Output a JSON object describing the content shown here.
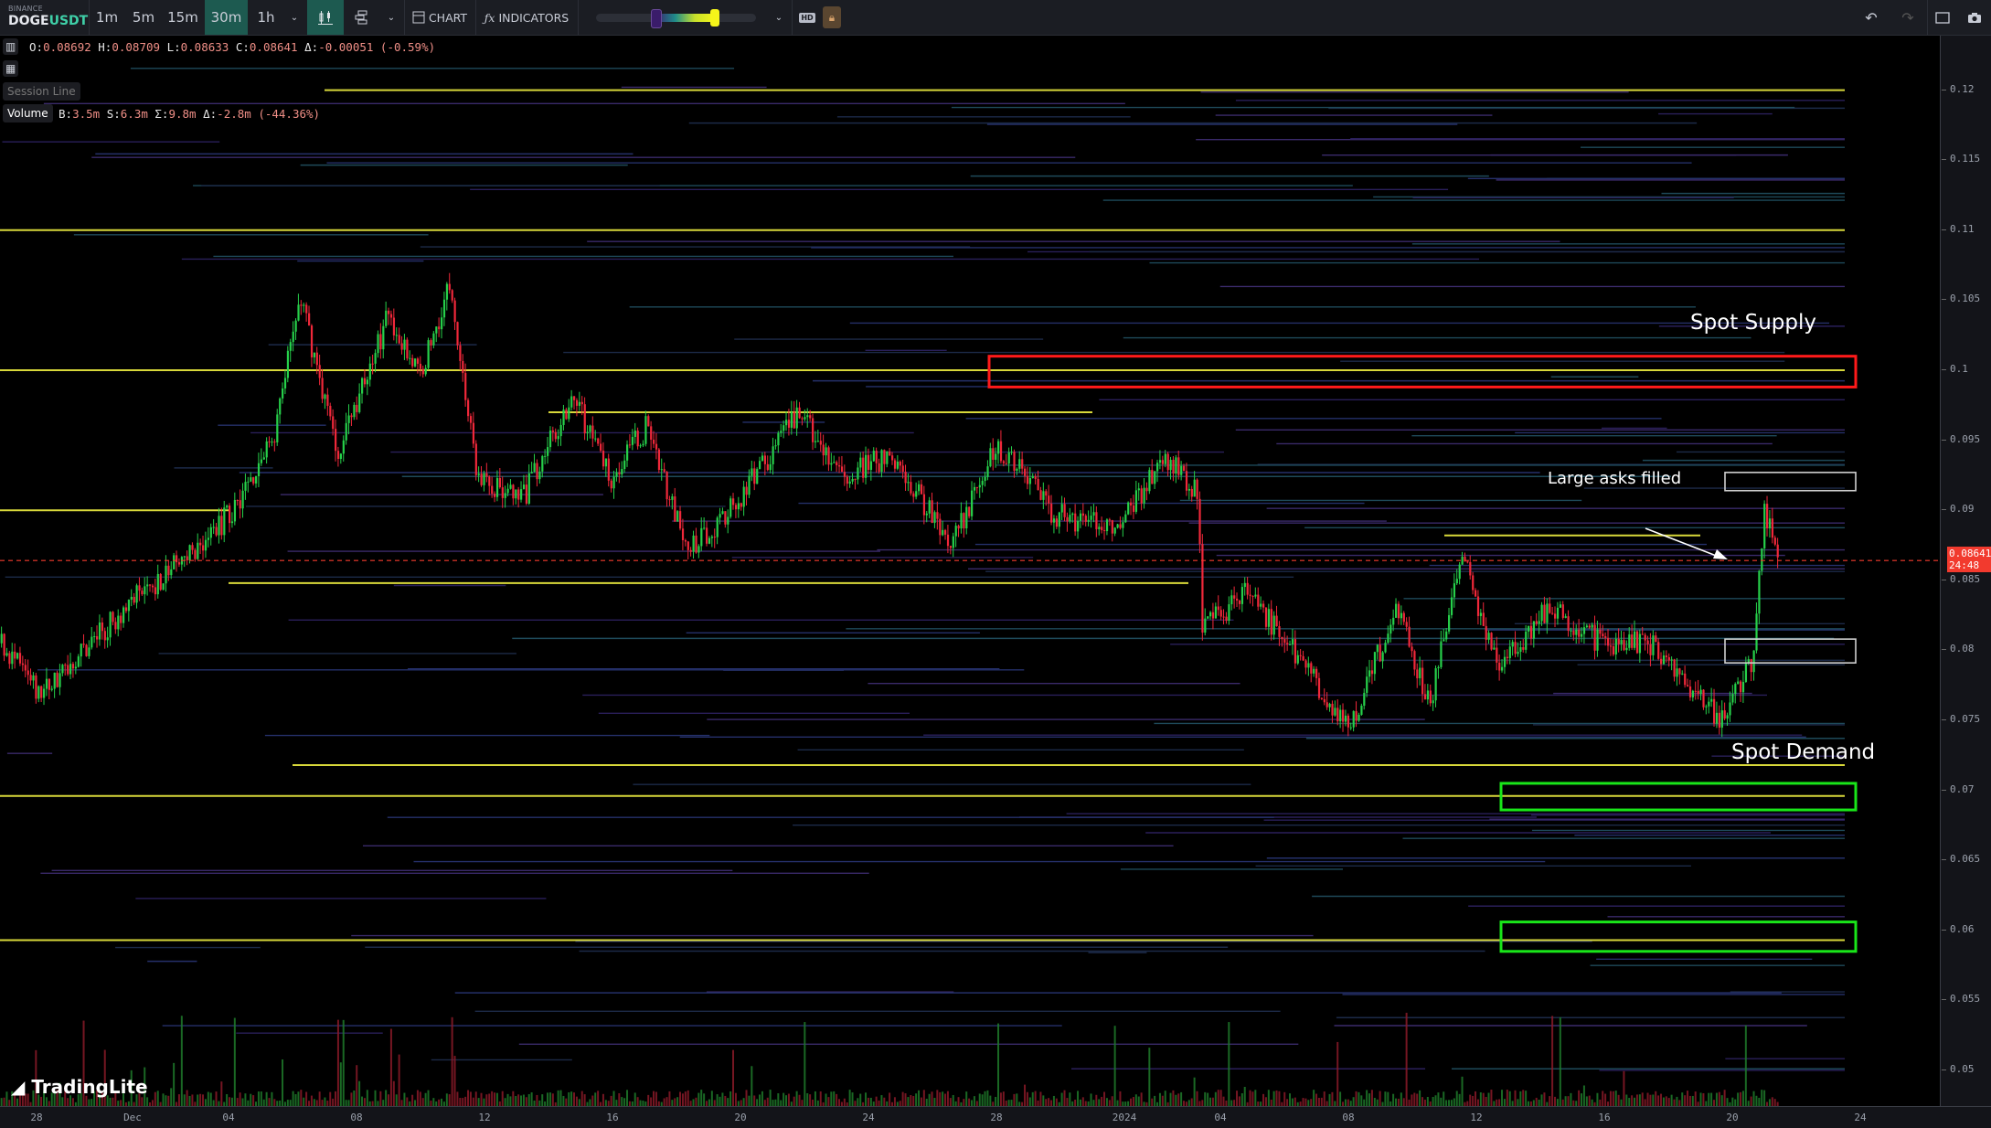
{
  "toolbar": {
    "exchange": "BINANCE",
    "symbol_base": "DOGE",
    "symbol_quote": "USDT",
    "timeframes": [
      "1m",
      "5m",
      "15m",
      "30m",
      "1h"
    ],
    "active_timeframe": "30m",
    "chart_label": "CHART",
    "indicators_label": "INDICATORS",
    "hd_label": "HD",
    "heatmap_gradient_low": 0.23,
    "heatmap_gradient_high": 0.6
  },
  "ohlc": {
    "o_label": "O:",
    "o": "0.08692",
    "h_label": "H:",
    "h": "0.08709",
    "l_label": "L:",
    "l": "0.08633",
    "c_label": "C:",
    "c": "0.08641",
    "d_label": "Δ:",
    "d": "-0.00051 (-0.59%)"
  },
  "session_line_label": "Session Line",
  "volume": {
    "label": "Volume",
    "b_label": "B:",
    "b": "3.5m",
    "s_label": "S:",
    "s": "6.3m",
    "sum_label": "Σ:",
    "sum": "9.8m",
    "d_label": "Δ:",
    "d": "-2.8m (-44.36%)"
  },
  "price_tag": {
    "price": "0.08641",
    "countdown": "24:48"
  },
  "annotations": {
    "supply": "Spot Supply",
    "demand": "Spot Demand",
    "asks": "Large asks filled"
  },
  "brand": "TradingLite",
  "colors": {
    "up": "#26d04a",
    "down": "#f0283a",
    "supply_box": "#ff1a1a",
    "demand_box": "#19e619",
    "level": "#d8d83a",
    "last_price": "#f23a2e"
  },
  "y_ticks": [
    "0.12",
    "0.115",
    "0.11",
    "0.105",
    "0.1",
    "0.095",
    "0.09",
    "0.085",
    "0.08",
    "0.075",
    "0.07",
    "0.065",
    "0.06",
    "0.055",
    "0.05"
  ],
  "x_ticks": [
    {
      "label": "28",
      "date": "2023-11-28"
    },
    {
      "label": "Dec",
      "date": "2023-12-01"
    },
    {
      "label": "04",
      "date": "2023-12-04"
    },
    {
      "label": "08",
      "date": "2023-12-08"
    },
    {
      "label": "12",
      "date": "2023-12-12"
    },
    {
      "label": "16",
      "date": "2023-12-16"
    },
    {
      "label": "20",
      "date": "2023-12-20"
    },
    {
      "label": "24",
      "date": "2023-12-24"
    },
    {
      "label": "28",
      "date": "2023-12-28"
    },
    {
      "label": "2024",
      "date": "2024-01-01"
    },
    {
      "label": "04",
      "date": "2024-01-04"
    },
    {
      "label": "08",
      "date": "2024-01-08"
    },
    {
      "label": "12",
      "date": "2024-01-12"
    },
    {
      "label": "16",
      "date": "2024-01-16"
    },
    {
      "label": "20",
      "date": "2024-01-20"
    },
    {
      "label": "24",
      "date": "2024-01-24"
    }
  ],
  "chart_data": {
    "type": "candlestick",
    "ylim": [
      0.0485,
      0.1245
    ],
    "xlim": [
      "2023-11-26T21:00",
      "2024-01-26T00:00"
    ],
    "last_price": 0.08641,
    "close_path": [
      [
        "2023-11-26T21:00",
        0.0805
      ],
      [
        "2023-11-28T01:00",
        0.0768
      ],
      [
        "2023-11-30T20:00",
        0.0833
      ],
      [
        "2023-12-02T19:00",
        0.0869
      ],
      [
        "2023-12-04T00:00",
        0.0897
      ],
      [
        "2023-12-05T09:00",
        0.0951
      ],
      [
        "2023-12-06T05:00",
        0.1052
      ],
      [
        "2023-12-07T09:00",
        0.0942
      ],
      [
        "2023-12-08T23:00",
        0.1038
      ],
      [
        "2023-12-09T23:00",
        0.0997
      ],
      [
        "2023-12-10T21:00",
        0.1061
      ],
      [
        "2023-12-11T18:00",
        0.0924
      ],
      [
        "2023-12-13T03:00",
        0.0906
      ],
      [
        "2023-12-14T17:00",
        0.0983
      ],
      [
        "2023-12-15T22:00",
        0.0924
      ],
      [
        "2023-12-17T02:00",
        0.0961
      ],
      [
        "2023-12-18T07:00",
        0.0869
      ],
      [
        "2023-12-19T21:00",
        0.0906
      ],
      [
        "2023-12-21T19:00",
        0.097
      ],
      [
        "2023-12-23T01:00",
        0.0924
      ],
      [
        "2023-12-24T15:00",
        0.0938
      ],
      [
        "2023-12-26T15:00",
        0.0878
      ],
      [
        "2023-12-28T00:00",
        0.0947
      ],
      [
        "2023-12-29T19:00",
        0.0897
      ],
      [
        "2023-12-31T19:00",
        0.0887
      ],
      [
        "2024-01-02T04:00",
        0.0938
      ],
      [
        "2024-01-03T06:00",
        0.0915
      ],
      [
        "2024-01-03T10:00",
        0.0814
      ],
      [
        "2024-01-04T18:00",
        0.0842
      ],
      [
        "2024-01-06T08:00",
        0.0796
      ],
      [
        "2024-01-08T01:00",
        0.0745
      ],
      [
        "2024-01-09T12:00",
        0.0833
      ],
      [
        "2024-01-10T12:00",
        0.076
      ],
      [
        "2024-01-11T12:00",
        0.0869
      ],
      [
        "2024-01-12T17:00",
        0.0787
      ],
      [
        "2024-01-14T06:00",
        0.0833
      ],
      [
        "2024-01-15T21:00",
        0.0805
      ],
      [
        "2024-01-17T11:00",
        0.0805
      ],
      [
        "2024-01-19T15:00",
        0.075
      ],
      [
        "2024-01-20T15:00",
        0.0796
      ],
      [
        "2024-01-20T23:00",
        0.0903
      ],
      [
        "2024-01-21T10:00",
        0.0864
      ]
    ],
    "heatmap_levels": [
      {
        "price": 0.12,
        "from": "2023-12-07",
        "to": "2024-01-25"
      },
      {
        "price": 0.11,
        "from": "2023-11-26",
        "to": "2024-01-25"
      },
      {
        "price": 0.1,
        "from": "2023-11-26",
        "to": "2024-01-25"
      },
      {
        "price": 0.097,
        "from": "2023-12-14",
        "to": "2023-12-31"
      },
      {
        "price": 0.09,
        "from": "2023-11-26",
        "to": "2023-12-04"
      },
      {
        "price": 0.0882,
        "from": "2024-01-11",
        "to": "2024-01-19"
      },
      {
        "price": 0.0848,
        "from": "2023-12-04",
        "to": "2024-01-03"
      },
      {
        "price": 0.0718,
        "from": "2023-12-06",
        "to": "2024-01-25"
      },
      {
        "price": 0.0696,
        "from": "2023-11-26",
        "to": "2024-01-25"
      },
      {
        "price": 0.0593,
        "from": "2023-11-26",
        "to": "2024-01-25"
      }
    ],
    "zones": [
      {
        "label": "Spot Supply",
        "kind": "supply",
        "low": 0.0988,
        "high": 0.101,
        "from": "2023-12-28",
        "to": "2024-01-24"
      },
      {
        "kind": "marker",
        "low": 0.0914,
        "high": 0.0927,
        "from": "2024-01-20",
        "to": "2024-01-24"
      },
      {
        "kind": "marker",
        "low": 0.0791,
        "high": 0.0808,
        "from": "2024-01-20",
        "to": "2024-01-24"
      },
      {
        "label": "Spot Demand",
        "kind": "demand",
        "low": 0.0686,
        "high": 0.0705,
        "from": "2024-01-13",
        "to": "2024-01-24"
      },
      {
        "kind": "demand",
        "low": 0.0585,
        "high": 0.0606,
        "from": "2024-01-13",
        "to": "2024-01-24"
      }
    ]
  }
}
